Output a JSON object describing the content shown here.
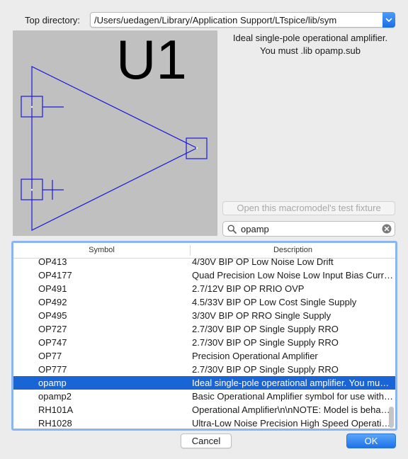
{
  "top_directory": {
    "label": "Top directory:",
    "value": "/Users/uedagen/Library/Application Support/LTspice/lib/sym"
  },
  "preview": {
    "reference_designator": "U1",
    "symbol_color": "#1a1adb",
    "background_color": "#c0c0c0"
  },
  "description": {
    "line1": "Ideal single-pole operational amplifier.",
    "line2": "You must .lib opamp.sub"
  },
  "fixture_button": {
    "label": "Open this macromodel's test fixture",
    "enabled": false
  },
  "search": {
    "value": "opamp",
    "icon": "search-icon",
    "clear_icon": "clear-icon"
  },
  "table": {
    "headers": {
      "symbol": "Symbol",
      "description": "Description"
    },
    "rows": [
      {
        "symbol": "OP413",
        "description": "4/30V BIP OP Low Noise Low Drift"
      },
      {
        "symbol": "OP4177",
        "description": "Quad Precision Low Noise Low Input Bias Current"
      },
      {
        "symbol": "OP491",
        "description": "2.7/12V BIP OP RRIO OVP"
      },
      {
        "symbol": "OP492",
        "description": "4.5/33V BIP OP Low Cost Single Supply"
      },
      {
        "symbol": "OP495",
        "description": "3/30V BIP OP RRO Single Supply"
      },
      {
        "symbol": "OP727",
        "description": "2.7/30V BIP OP Single Supply RRO"
      },
      {
        "symbol": "OP747",
        "description": "2.7/30V BIP OP Single Supply RRO"
      },
      {
        "symbol": "OP77",
        "description": "Precision Operational Amplifier"
      },
      {
        "symbol": "OP777",
        "description": "2.7/30V BIP OP Single Supply RRO"
      },
      {
        "symbol": "opamp",
        "description": "Ideal single-pole operational amplifier. You must .lib opamp.sub",
        "selected": true
      },
      {
        "symbol": "opamp2",
        "description": "Basic Operational Amplifier symbol for use with a model"
      },
      {
        "symbol": "RH101A",
        "description": "Operational Amplifier\\n\\nNOTE: Model is behavioral"
      },
      {
        "symbol": "RH1028",
        "description": "Ultra-Low Noise Precision High Speed Operational Amplifier"
      }
    ]
  },
  "buttons": {
    "cancel": "Cancel",
    "ok": "OK"
  },
  "colors": {
    "selection": "#1a65d6",
    "accent": "#1d72e8",
    "table_focus_ring": "#8ab5f0"
  }
}
